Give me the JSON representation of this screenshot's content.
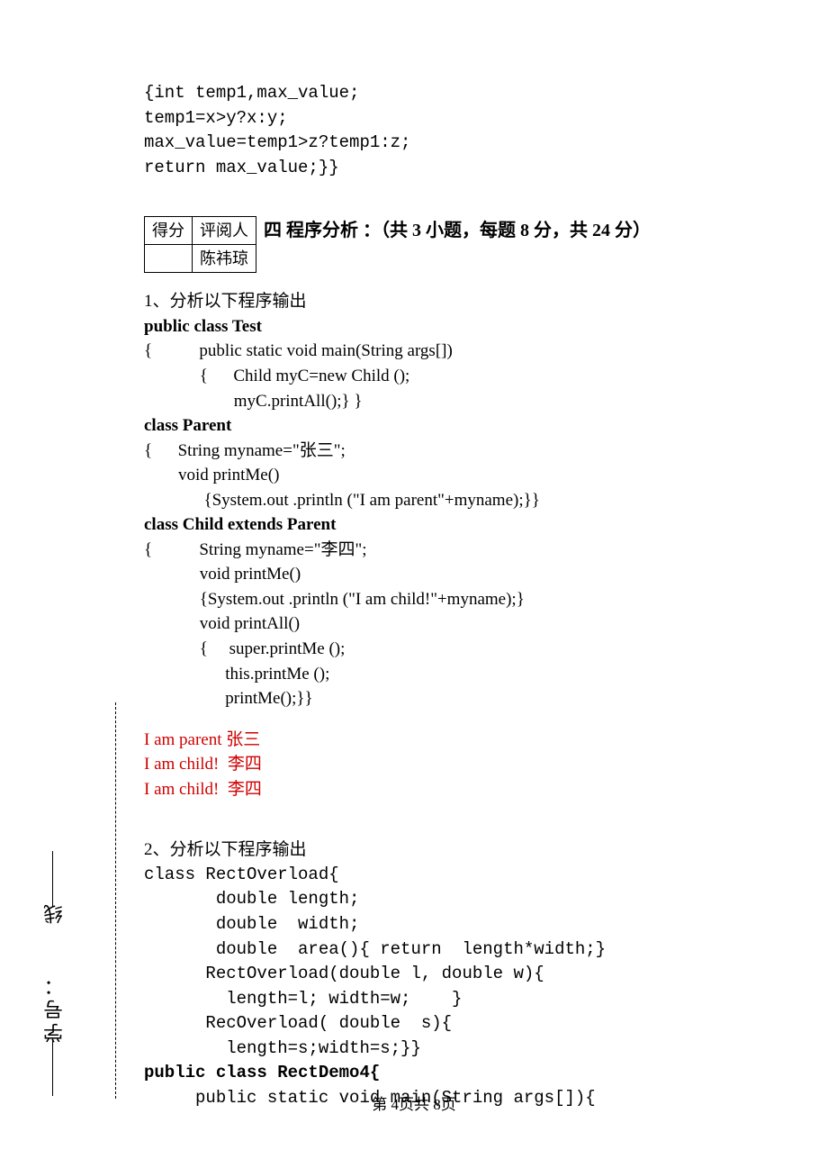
{
  "code_top": "{int temp1,max_value;\ntemp1=x>y?x:y;\nmax_value=temp1>z?temp1:z;\nreturn max_value;}}",
  "score_table": {
    "h1": "得分",
    "h2": "评阅人",
    "name": "陈祎琼"
  },
  "section4_title": "四 程序分析 ：（共 3 小题，每题 8 分，共 24 分）",
  "q1_prompt": "1、分析以下程序输出",
  "q1_code": {
    "l1": "public class Test",
    "l2": "{           public static void main(String args[])",
    "l3": "             {      Child myC=new Child ();",
    "l4": "                     myC.printAll();} }",
    "l5": "class Parent",
    "l6": "{      String myname=\"张三\";",
    "l7": "        void printMe()",
    "l8": "              {System.out .println (\"I am parent\"+myname);}}",
    "l9": "class Child extends Parent",
    "l10": "{           String myname=\"李四\";",
    "l11": "             void printMe()",
    "l12": "             {System.out .println (\"I am child!\"+myname);}",
    "l13": "             void printAll()",
    "l14": "             {     super.printMe ();",
    "l15": "                   this.printMe ();",
    "l16": "                   printMe();}}"
  },
  "q1_output": {
    "o1": "I am parent 张三",
    "o2": "I am child!  李四",
    "o3": "I am child!  李四"
  },
  "q2_prompt": "2、分析以下程序输出",
  "q2_code": {
    "l1": "class RectOverload{",
    "l2": "       double length;",
    "l3": "       double  width;",
    "l4": "       double  area(){ return  length*width;}",
    "l5": "      RectOverload(double l, double w){",
    "l6": "        length=l; width=w;    }",
    "l7": "      RecOverload( double  s){",
    "l8": "        length=s;width=s;}}",
    "l9": "public class RectDemo4{",
    "l10": "     public static void main(String args[]){"
  },
  "side": {
    "xian": "线",
    "xuehao": "学号："
  },
  "footer": "第 4页共 8页"
}
